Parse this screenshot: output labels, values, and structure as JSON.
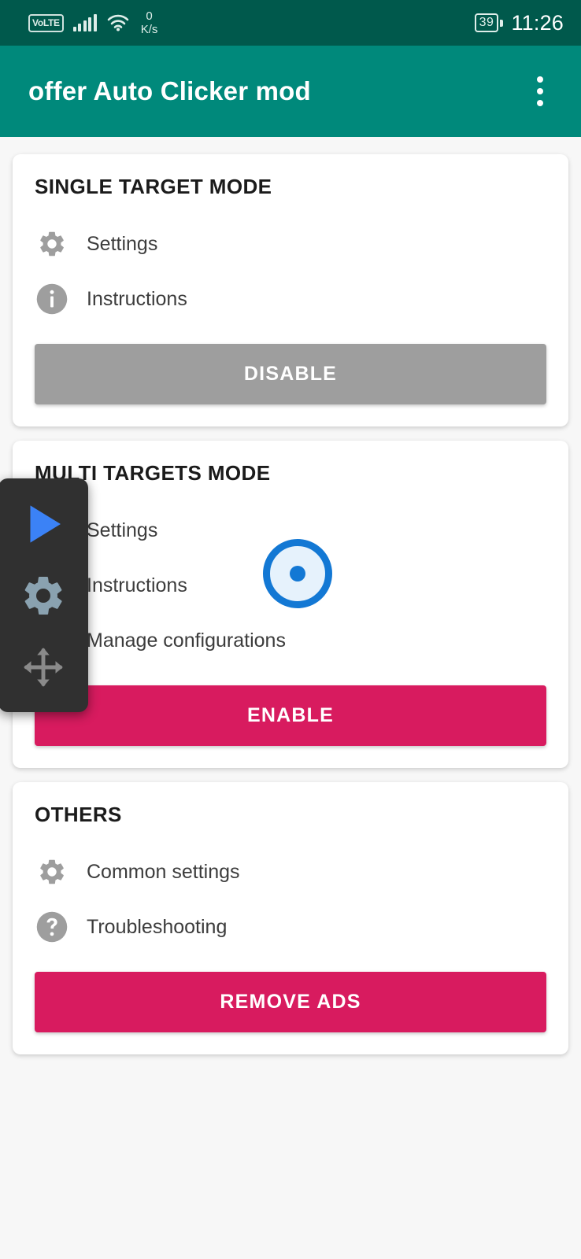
{
  "status_bar": {
    "volte_label": "VoLTE",
    "signal_icon": "signal-bars-icon",
    "wifi_icon": "wifi-icon",
    "net_speed_value": "0",
    "net_speed_unit": "K/s",
    "battery_percent": "39",
    "time": "11:26",
    "background_color": "#00594c"
  },
  "app_bar": {
    "title": "offer Auto Clicker mod",
    "overflow_icon": "more-vert-icon",
    "background_color": "#00897b"
  },
  "colors": {
    "accent_pink": "#d81b5f",
    "disabled_grey": "#9e9e9e",
    "target_blue": "#1378d4",
    "page_background": "#f7f7f7"
  },
  "cards": [
    {
      "title": "SINGLE TARGET MODE",
      "rows": [
        {
          "icon": "gear-icon",
          "label": "Settings"
        },
        {
          "icon": "info-icon",
          "label": "Instructions"
        }
      ],
      "button": {
        "label": "DISABLE",
        "style": "disabled"
      }
    },
    {
      "title": "MULTI TARGETS MODE",
      "rows": [
        {
          "icon": "gear-icon",
          "label": "Settings"
        },
        {
          "icon": "info-icon",
          "label": "Instructions"
        },
        {
          "icon": "list-icon",
          "label": "Manage configurations"
        }
      ],
      "button": {
        "label": "ENABLE",
        "style": "primary"
      },
      "target_marker": "target-point-marker"
    },
    {
      "title": "OTHERS",
      "rows": [
        {
          "icon": "gear-icon",
          "label": "Common settings"
        },
        {
          "icon": "help-icon",
          "label": "Troubleshooting"
        }
      ],
      "button": {
        "label": "REMOVE ADS",
        "style": "primary"
      }
    }
  ],
  "overlay_panel": {
    "background_color": "#303030",
    "buttons": [
      {
        "icon": "play-icon",
        "color": "#3b82f6"
      },
      {
        "icon": "gear-icon",
        "color": "#8aa2b0"
      },
      {
        "icon": "move-icon",
        "color": "#8a8a8a"
      }
    ]
  }
}
